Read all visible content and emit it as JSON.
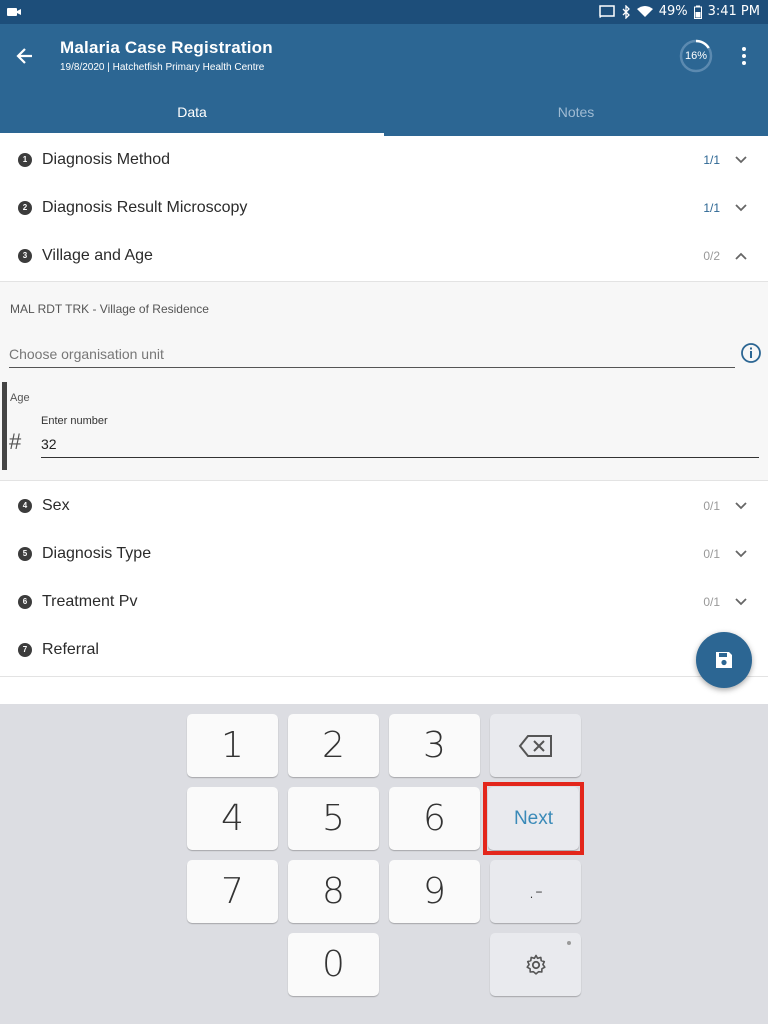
{
  "status_bar": {
    "battery": "49%",
    "time": "3:41 PM"
  },
  "app_bar": {
    "title": "Malaria Case Registration",
    "subtitle": "19/8/2020 | Hatchetfish Primary Health Centre",
    "progress": "16%",
    "progress_fraction": 0.16
  },
  "tabs": [
    {
      "label": "Data",
      "active": true
    },
    {
      "label": "Notes",
      "active": false
    }
  ],
  "sections": [
    {
      "num": "1",
      "label": "Diagnosis Method",
      "count": "1/1",
      "expanded": false
    },
    {
      "num": "2",
      "label": "Diagnosis Result Microscopy",
      "count": "1/1",
      "expanded": false
    },
    {
      "num": "3",
      "label": "Village and Age",
      "count": "0/2",
      "expanded": true
    },
    {
      "num": "4",
      "label": "Sex",
      "count": "0/1",
      "expanded": false
    },
    {
      "num": "5",
      "label": "Diagnosis Type",
      "count": "0/1",
      "expanded": false
    },
    {
      "num": "6",
      "label": "Treatment Pv",
      "count": "0/1",
      "expanded": false
    },
    {
      "num": "7",
      "label": "Referral",
      "count": "",
      "expanded": false
    }
  ],
  "form": {
    "ou_label": "MAL RDT TRK - Village of Residence",
    "ou_placeholder": "Choose organisation unit",
    "age_label": "Age",
    "age_hint": "Enter number",
    "age_value": "32"
  },
  "keyboard": {
    "keys": [
      "1",
      "2",
      "3",
      "4",
      "5",
      "6",
      "7",
      "8",
      "9",
      "0"
    ],
    "next_label": "Next",
    "punct_label": ".-"
  },
  "colors": {
    "primary": "#2c6693",
    "status_bar": "#1d4e7a",
    "highlight": "#e3261b"
  }
}
